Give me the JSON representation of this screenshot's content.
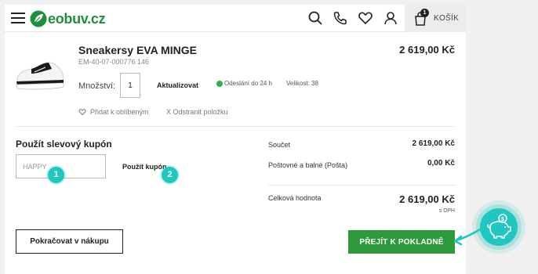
{
  "header": {
    "logo_text": "eobuv.cz",
    "cart_count": "1",
    "cart_label": "KOŠÍK"
  },
  "product": {
    "name": "Sneakersy EVA MINGE",
    "code": "EM-40-07-000776 146",
    "price": "2 619,00 Kč",
    "quantity_label": "Množství:",
    "quantity_value": "1",
    "update_label": "Aktualizovat",
    "shipping": "Odeslání do 24 h",
    "size": "Velikost: 38",
    "favorite_label": "Přidat k oblíbeným",
    "remove_label": "X Odstranit položku"
  },
  "coupon": {
    "title": "Použít slevový kupón",
    "placeholder": "HAPPY",
    "apply_label": "Použít kupón",
    "step1": "1",
    "step2": "2"
  },
  "totals": {
    "subtotal_label": "Součet",
    "subtotal_value": "2 619,00 Kč",
    "shipping_label": "Poštovné a balné (Pošta)",
    "shipping_value": "0,00 Kč",
    "total_label": "Celková hodnota",
    "total_value": "2 619,00 Kč",
    "vat_note": "s DPH"
  },
  "actions": {
    "continue_label": "Pokračovat v nákupu",
    "checkout_label": "PŘEJÍT K POKLADNĚ"
  },
  "colors": {
    "brand_green": "#1e8f3a",
    "checkout_green": "#2f9a3b",
    "accent_teal": "#1fc7c0"
  },
  "icons": [
    "menu-icon",
    "search-icon",
    "phone-icon",
    "heart-icon",
    "user-icon",
    "shopping-bag-icon",
    "piggy-bank-icon"
  ]
}
